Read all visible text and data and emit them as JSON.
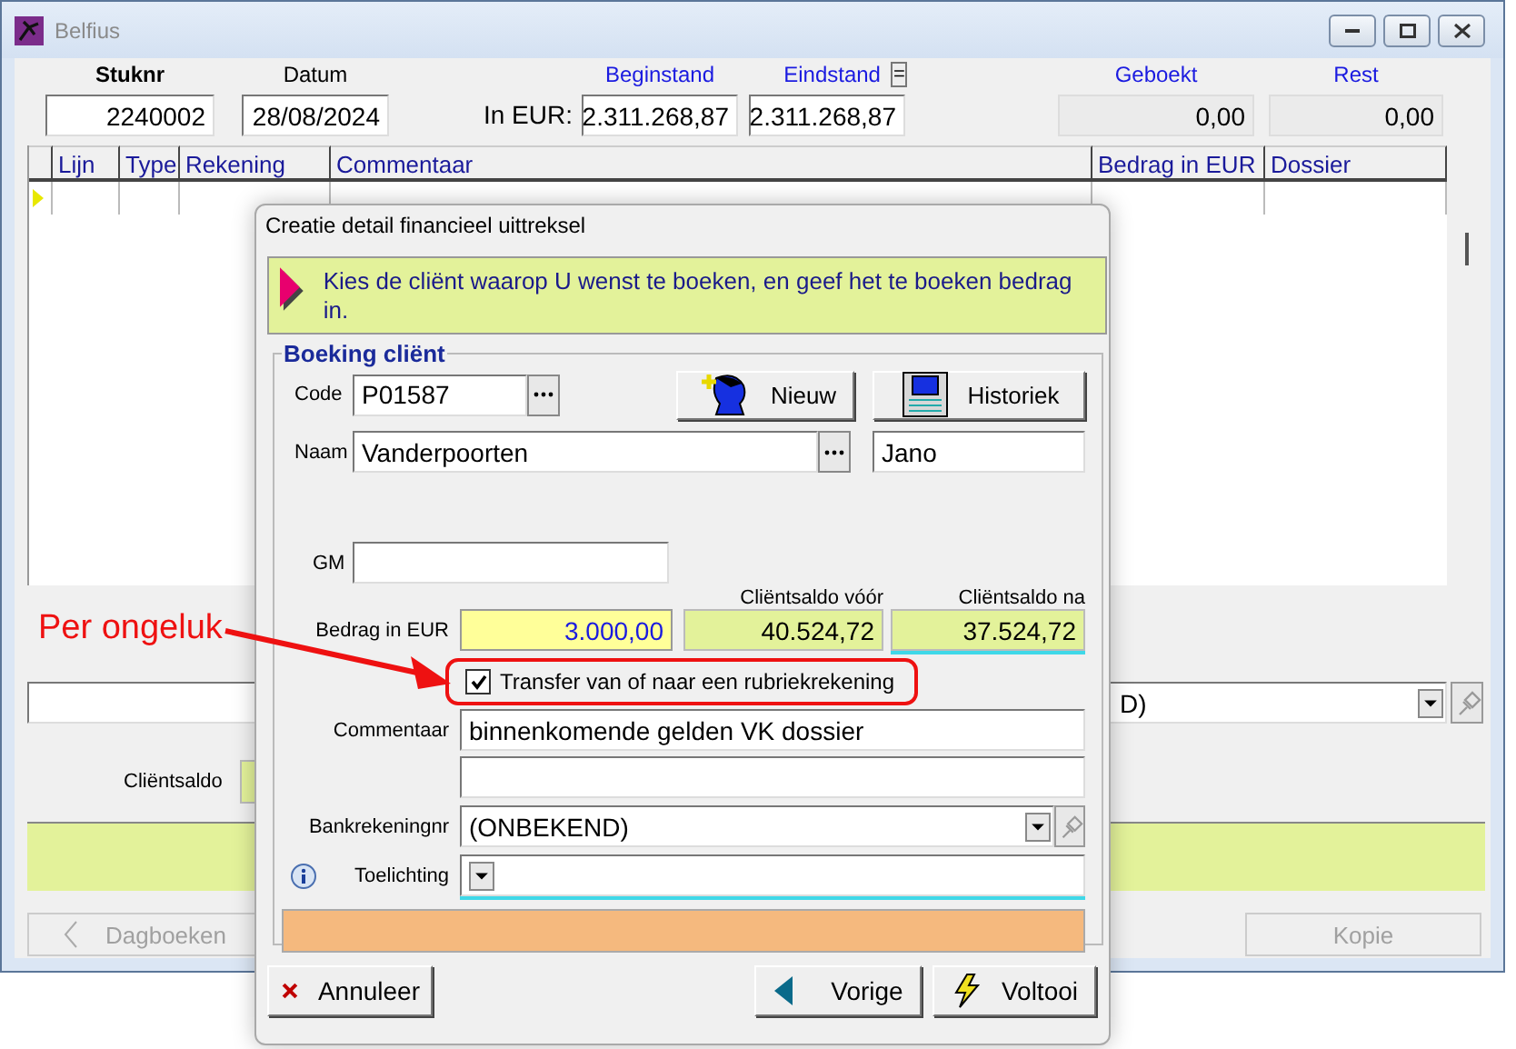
{
  "window": {
    "title": "Belfius"
  },
  "header": {
    "currency_label": "In EUR:",
    "fields": [
      {
        "kind": "key",
        "label": "Stuknr",
        "value": "2240002"
      },
      {
        "kind": "plain",
        "label": "Datum",
        "value": "28/08/2024"
      },
      {
        "kind": "amount",
        "label": "Beginstand",
        "value": "2.311.268,87"
      },
      {
        "kind": "amount",
        "label": "Eindstand",
        "value": "2.311.268,87",
        "button": "="
      },
      {
        "kind": "readonly",
        "label": "Geboekt",
        "value": "0,00"
      },
      {
        "kind": "readonly",
        "label": "Rest",
        "value": "0,00"
      }
    ]
  },
  "grid": {
    "columns": [
      "Lijn",
      "Type",
      "Rekening",
      "Commentaar",
      "Bedrag in EUR",
      "Dossier"
    ]
  },
  "lower": {
    "combo_value": "D)",
    "client_balance_label": "Cliëntsaldo",
    "buttons": [
      {
        "kind": "back",
        "label": "Dagboeken",
        "disabled": true
      },
      {
        "kind": "copy",
        "label": "Kopie",
        "disabled": true
      }
    ]
  },
  "dialog": {
    "title": "Creatie detail financieel uittreksel",
    "instruction": "Kies de cliënt waarop U wenst te boeken, en geef het te boeken bedrag in.",
    "group_title": "Boeking cliënt",
    "code": {
      "label": "Code",
      "value": "P01587"
    },
    "client_buttons": [
      {
        "kind": "new",
        "label": "Nieuw"
      },
      {
        "kind": "history",
        "label": "Historiek"
      }
    ],
    "naam": {
      "label": "Naam",
      "value": "Vanderpoorten",
      "first_name": "Jano"
    },
    "gm": {
      "label": "GM"
    },
    "bedrag": {
      "label": "Bedrag in EUR",
      "value": "3.000,00"
    },
    "saldo_voor": {
      "label": "Cliëntsaldo vóór",
      "value": "40.524,72"
    },
    "saldo_na": {
      "label": "Cliëntsaldo na",
      "value": "37.524,72"
    },
    "transfer": {
      "label": "Transfer van of naar een rubriekrekening",
      "checked": true
    },
    "commentaar": {
      "label": "Commentaar",
      "value": "binnenkomende gelden VK dossier"
    },
    "bankrekeningnr": {
      "label": "Bankrekeningnr",
      "value": "(ONBEKEND)"
    },
    "toelichting": {
      "label": "Toelichting"
    },
    "buttons": [
      {
        "kind": "cancel",
        "label": "Annuleer"
      },
      {
        "kind": "back",
        "label": "Vorige"
      },
      {
        "kind": "finish",
        "label": "Voltooi"
      }
    ]
  },
  "annotation": {
    "text": "Per ongeluk"
  }
}
